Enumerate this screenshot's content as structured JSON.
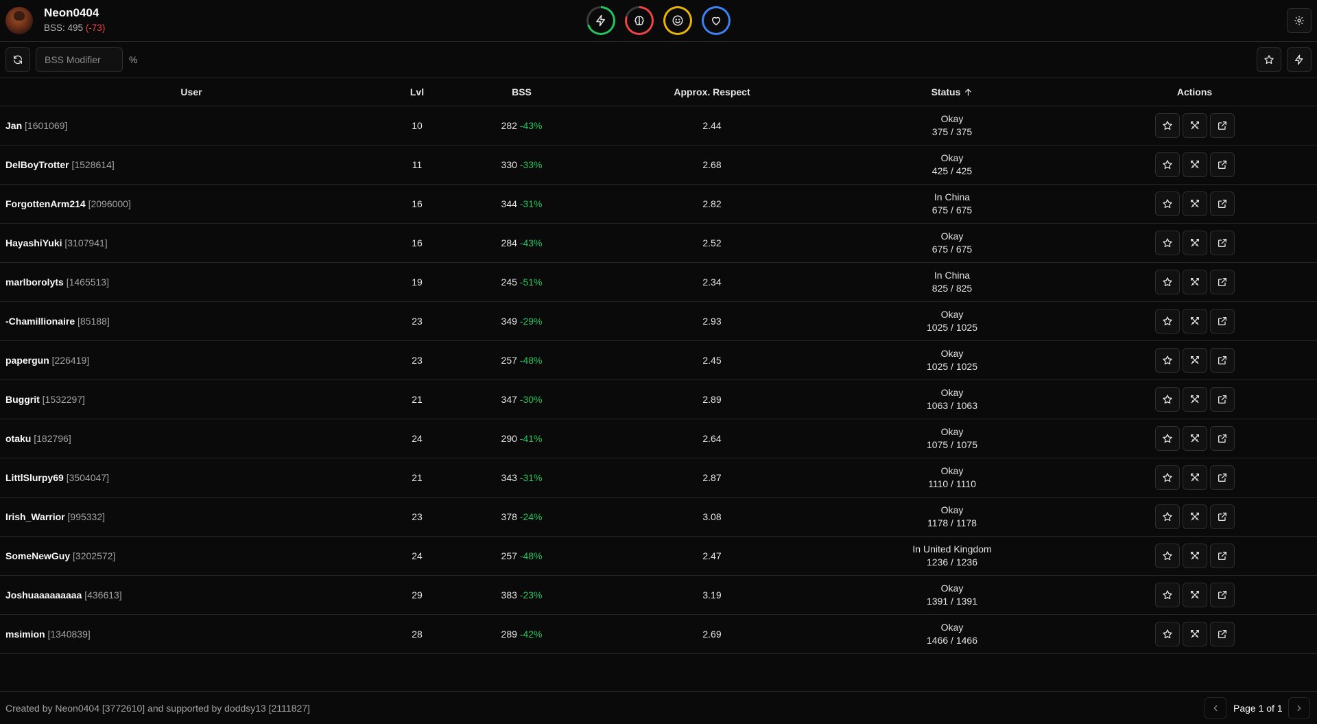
{
  "header": {
    "username": "Neon0404",
    "bss_prefix": "BSS: 495",
    "bss_change": "(-73)"
  },
  "stats": [
    {
      "name": "energy",
      "icon": "lightning-icon",
      "color": "#22c55e",
      "fill": 0.7
    },
    {
      "name": "nerve",
      "icon": "brain-icon",
      "color": "#ef4444",
      "fill": 0.8
    },
    {
      "name": "happy",
      "icon": "smiley-icon",
      "color": "#eab308",
      "fill": 1.0
    },
    {
      "name": "life",
      "icon": "heart-icon",
      "color": "#3b82f6",
      "fill": 1.0
    }
  ],
  "toolbar": {
    "modifier_placeholder": "BSS Modifier",
    "percent_label": "%"
  },
  "table": {
    "headers": {
      "user": "User",
      "lvl": "Lvl",
      "bss": "BSS",
      "respect": "Approx. Respect",
      "status": "Status",
      "actions": "Actions"
    },
    "rows": [
      {
        "name": "Jan",
        "id": "[1601069]",
        "lvl": "10",
        "bss": "282",
        "diff": "-43%",
        "respect": "2.44",
        "status": "Okay",
        "life": "375 / 375"
      },
      {
        "name": "DelBoyTrotter",
        "id": "[1528614]",
        "lvl": "11",
        "bss": "330",
        "diff": "-33%",
        "respect": "2.68",
        "status": "Okay",
        "life": "425 / 425"
      },
      {
        "name": "ForgottenArm214",
        "id": "[2096000]",
        "lvl": "16",
        "bss": "344",
        "diff": "-31%",
        "respect": "2.82",
        "status": "In China",
        "life": "675 / 675"
      },
      {
        "name": "HayashiYuki",
        "id": "[3107941]",
        "lvl": "16",
        "bss": "284",
        "diff": "-43%",
        "respect": "2.52",
        "status": "Okay",
        "life": "675 / 675"
      },
      {
        "name": "marlborolyts",
        "id": "[1465513]",
        "lvl": "19",
        "bss": "245",
        "diff": "-51%",
        "respect": "2.34",
        "status": "In China",
        "life": "825 / 825"
      },
      {
        "name": "-Chamillionaire",
        "id": "[85188]",
        "lvl": "23",
        "bss": "349",
        "diff": "-29%",
        "respect": "2.93",
        "status": "Okay",
        "life": "1025 / 1025"
      },
      {
        "name": "papergun",
        "id": "[226419]",
        "lvl": "23",
        "bss": "257",
        "diff": "-48%",
        "respect": "2.45",
        "status": "Okay",
        "life": "1025 / 1025"
      },
      {
        "name": "Buggrit",
        "id": "[1532297]",
        "lvl": "21",
        "bss": "347",
        "diff": "-30%",
        "respect": "2.89",
        "status": "Okay",
        "life": "1063 / 1063"
      },
      {
        "name": "otaku",
        "id": "[182796]",
        "lvl": "24",
        "bss": "290",
        "diff": "-41%",
        "respect": "2.64",
        "status": "Okay",
        "life": "1075 / 1075"
      },
      {
        "name": "LittlSlurpy69",
        "id": "[3504047]",
        "lvl": "21",
        "bss": "343",
        "diff": "-31%",
        "respect": "2.87",
        "status": "Okay",
        "life": "1110 / 1110"
      },
      {
        "name": "Irish_Warrior",
        "id": "[995332]",
        "lvl": "23",
        "bss": "378",
        "diff": "-24%",
        "respect": "3.08",
        "status": "Okay",
        "life": "1178 / 1178"
      },
      {
        "name": "SomeNewGuy",
        "id": "[3202572]",
        "lvl": "24",
        "bss": "257",
        "diff": "-48%",
        "respect": "2.47",
        "status": "In United Kingdom",
        "life": "1236 / 1236"
      },
      {
        "name": "Joshuaaaaaaaaa",
        "id": "[436613]",
        "lvl": "29",
        "bss": "383",
        "diff": "-23%",
        "respect": "3.19",
        "status": "Okay",
        "life": "1391 / 1391"
      },
      {
        "name": "msimion",
        "id": "[1340839]",
        "lvl": "28",
        "bss": "289",
        "diff": "-42%",
        "respect": "2.69",
        "status": "Okay",
        "life": "1466 / 1466"
      }
    ]
  },
  "footer": {
    "credits": "Created by Neon0404 [3772610] and supported by doddsy13 [2111827]",
    "page_label": "Page 1 of 1"
  }
}
